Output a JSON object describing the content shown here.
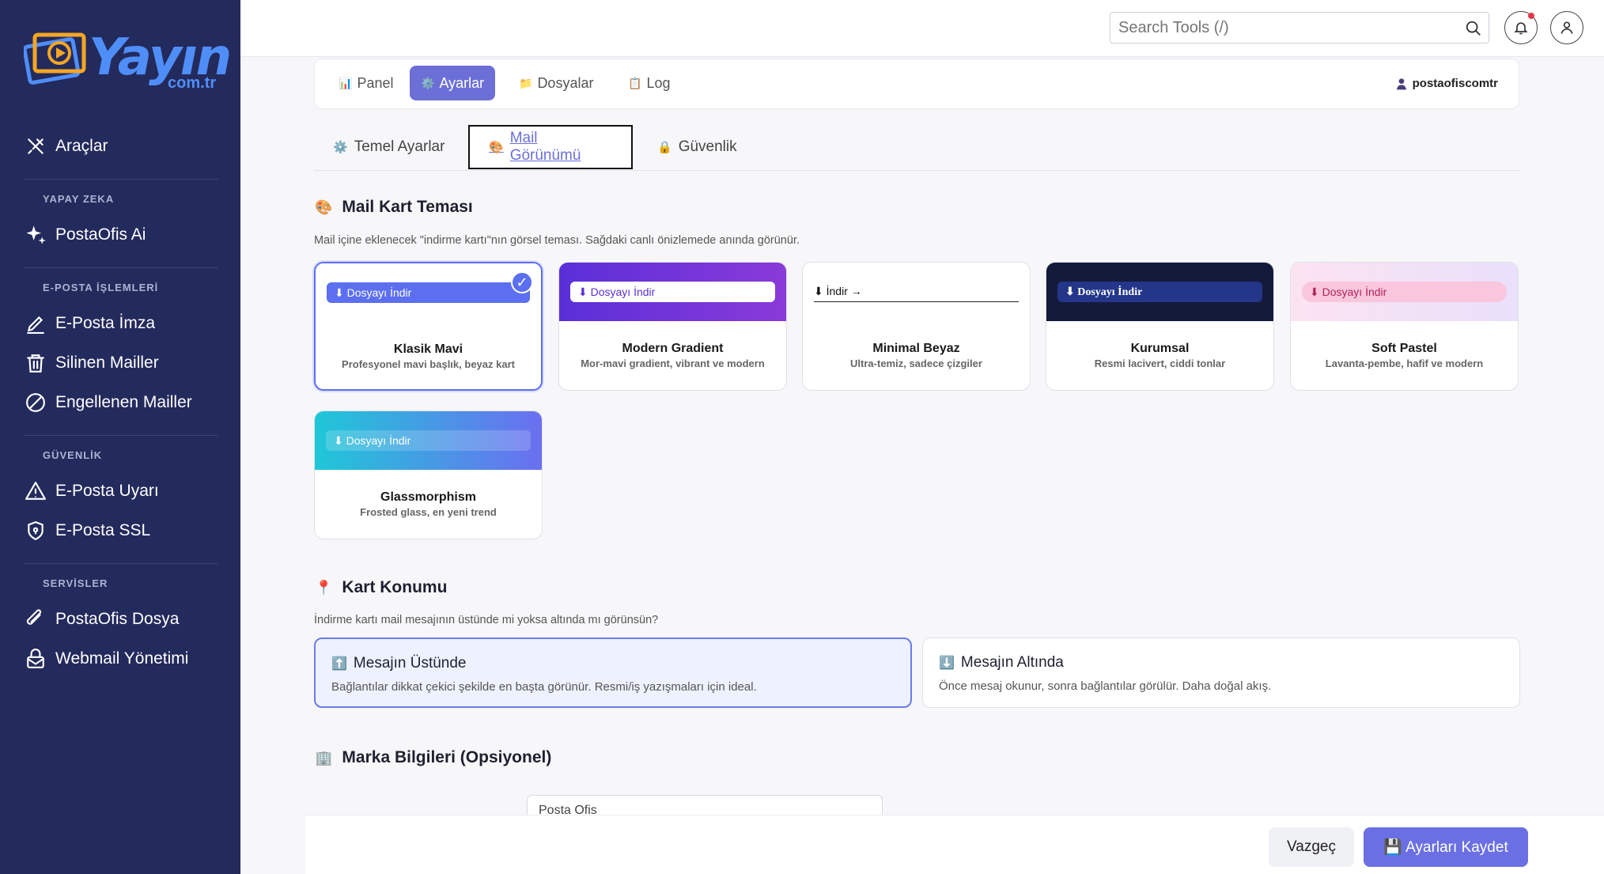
{
  "brand": {
    "logo_text": "Yayın",
    "logo_sub": "com.tr",
    "accent": "#4f8ef7"
  },
  "sidebar": {
    "items": [
      {
        "label": "Araçlar",
        "icon": "tools-icon"
      },
      {
        "section": "YAPAY ZEKA"
      },
      {
        "label": "PostaOfis Ai",
        "icon": "sparkle-icon"
      },
      {
        "section": "E-POSTA İŞLEMLERİ"
      },
      {
        "label": "E-Posta İmza",
        "icon": "pen-icon"
      },
      {
        "label": "Silinen Mailler",
        "icon": "trash-icon"
      },
      {
        "label": "Engellenen Mailler",
        "icon": "block-icon"
      },
      {
        "section": "GÜVENLİK"
      },
      {
        "label": "E-Posta Uyarı",
        "icon": "warning-icon"
      },
      {
        "label": "E-Posta SSL",
        "icon": "shield-icon"
      },
      {
        "section": "SERVİSLER"
      },
      {
        "label": "PostaOfis Dosya",
        "icon": "paperclip-icon"
      },
      {
        "label": "Webmail Yönetimi",
        "icon": "mail-lock-icon"
      }
    ]
  },
  "topbar": {
    "search_placeholder": "Search Tools (/)"
  },
  "main_tabs": [
    {
      "label": "Panel",
      "emoji": "📊"
    },
    {
      "label": "Ayarlar",
      "emoji": "⚙️"
    },
    {
      "label": "Dosyalar",
      "emoji": "📁"
    },
    {
      "label": "Log",
      "emoji": "📋"
    }
  ],
  "username": "postaofiscomtr",
  "sub_tabs": [
    {
      "label": "Temel Ayarlar",
      "emoji": "⚙️"
    },
    {
      "label": "Mail Görünümü",
      "emoji": "🎨"
    },
    {
      "label": "Güvenlik",
      "emoji": "🔒"
    }
  ],
  "theme_section": {
    "emoji": "🎨",
    "title": "Mail Kart Teması",
    "description": "Mail içine eklenecek \"indirme kartı\"nın görsel teması. Sağdaki canlı önizlemede anında görünür.",
    "themes": [
      {
        "button": "⬇ Dosyayı İndir",
        "name": "Klasik Mavi",
        "desc": "Profesyonel mavi başlık, beyaz kart",
        "selected": true
      },
      {
        "button": "⬇ Dosyayı İndir",
        "name": "Modern Gradient",
        "desc": "Mor-mavi gradient, vibrant ve modern"
      },
      {
        "button": "⬇ İndir →",
        "name": "Minimal Beyaz",
        "desc": "Ultra-temiz, sadece çizgiler"
      },
      {
        "button": "⬇ Dosyayı İndir",
        "name": "Kurumsal",
        "desc": "Resmi lacivert, ciddi tonlar"
      },
      {
        "button": "⬇ Dosyayı İndir",
        "name": "Soft Pastel",
        "desc": "Lavanta-pembe, hafif ve modern"
      },
      {
        "button": "⬇ Dosyayı İndir",
        "name": "Glassmorphism",
        "desc": "Frosted glass, en yeni trend"
      }
    ]
  },
  "position_section": {
    "emoji": "📍",
    "title": "Kart Konumu",
    "description": "İndirme kartı mail mesajının üstünde mi yoksa altında mı görünsün?",
    "options": [
      {
        "emoji": "⬆️",
        "title": "Mesajın Üstünde",
        "desc": "Bağlantılar dikkat çekici şekilde en başta görünür. Resmi/iş yazışmaları için ideal.",
        "selected": true
      },
      {
        "emoji": "⬇️",
        "title": "Mesajın Altında",
        "desc": "Önce mesaj okunur, sonra bağlantılar görülür. Daha doğal akış."
      }
    ]
  },
  "brand_section": {
    "emoji": "🏢",
    "title": "Marka Bilgileri (Opsiyonel)",
    "input_value": "Posta Ofis"
  },
  "footer": {
    "cancel": "Vazgeç",
    "save": "💾 Ayarları Kaydet"
  }
}
